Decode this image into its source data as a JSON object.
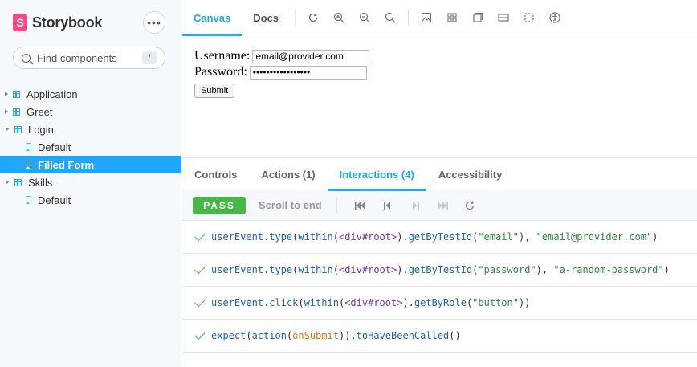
{
  "brand": {
    "name": "Storybook",
    "logo_letter": "S"
  },
  "sidebar": {
    "menu_label": "•••",
    "search_placeholder": "Find components",
    "search_shortcut": "/",
    "tree": [
      {
        "label": "Application",
        "type": "component",
        "expanded": false
      },
      {
        "label": "Greet",
        "type": "component",
        "expanded": false
      },
      {
        "label": "Login",
        "type": "component",
        "expanded": true
      },
      {
        "label": "Default",
        "type": "story",
        "selected": false
      },
      {
        "label": "Filled Form",
        "type": "story",
        "selected": true
      },
      {
        "label": "Skills",
        "type": "component",
        "expanded": true
      },
      {
        "label": "Default",
        "type": "story",
        "selected": false
      }
    ]
  },
  "toolbar": {
    "tabs": [
      {
        "label": "Canvas",
        "active": true
      },
      {
        "label": "Docs",
        "active": false
      }
    ],
    "icons": [
      "refresh-icon",
      "zoom-in-icon",
      "zoom-out-icon",
      "zoom-reset-icon",
      "background-icon",
      "grid-icon",
      "measure-icon",
      "viewport-icon",
      "outline-icon",
      "accessibility-icon"
    ]
  },
  "canvas": {
    "username_label": "Username:",
    "username_value": "email@provider.com",
    "password_label": "Password:",
    "password_value": "a-random-password",
    "submit_label": "Submit"
  },
  "panel": {
    "tabs": [
      {
        "label": "Controls",
        "active": false
      },
      {
        "label": "Actions (1)",
        "active": false
      },
      {
        "label": "Interactions (4)",
        "active": true
      },
      {
        "label": "Accessibility",
        "active": false
      }
    ],
    "status": "PASS",
    "scroll_label": "Scroll to end",
    "steps": [
      [
        [
          "fn",
          "userEvent.type"
        ],
        [
          "p",
          "("
        ],
        [
          "fn",
          "within"
        ],
        [
          "p",
          "("
        ],
        [
          "el",
          "<div#root>"
        ],
        [
          "p",
          ")."
        ],
        [
          "fn",
          "getByTestId"
        ],
        [
          "p",
          "("
        ],
        [
          "str",
          "\"email\""
        ],
        [
          "p",
          "), "
        ],
        [
          "str",
          "\"email@provider.com\""
        ],
        [
          "p",
          ")"
        ]
      ],
      [
        [
          "fn",
          "userEvent.type"
        ],
        [
          "p",
          "("
        ],
        [
          "fn",
          "within"
        ],
        [
          "p",
          "("
        ],
        [
          "el",
          "<div#root>"
        ],
        [
          "p",
          ")."
        ],
        [
          "fn",
          "getByTestId"
        ],
        [
          "p",
          "("
        ],
        [
          "str",
          "\"password\""
        ],
        [
          "p",
          "), "
        ],
        [
          "str",
          "\"a-random-password\""
        ],
        [
          "p",
          ")"
        ]
      ],
      [
        [
          "fn",
          "userEvent.click"
        ],
        [
          "p",
          "("
        ],
        [
          "fn",
          "within"
        ],
        [
          "p",
          "("
        ],
        [
          "el",
          "<div#root>"
        ],
        [
          "p",
          ")."
        ],
        [
          "fn",
          "getByRole"
        ],
        [
          "p",
          "("
        ],
        [
          "str",
          "\"button\""
        ],
        [
          "p",
          "))"
        ]
      ],
      [
        [
          "fn",
          "expect"
        ],
        [
          "p",
          "("
        ],
        [
          "fn",
          "action"
        ],
        [
          "p",
          "("
        ],
        [
          "var",
          "onSubmit"
        ],
        [
          "p",
          ")"
        ],
        [
          "p",
          ")."
        ],
        [
          "fn",
          "toHaveBeenCalled"
        ],
        [
          "p",
          "()"
        ]
      ]
    ]
  }
}
